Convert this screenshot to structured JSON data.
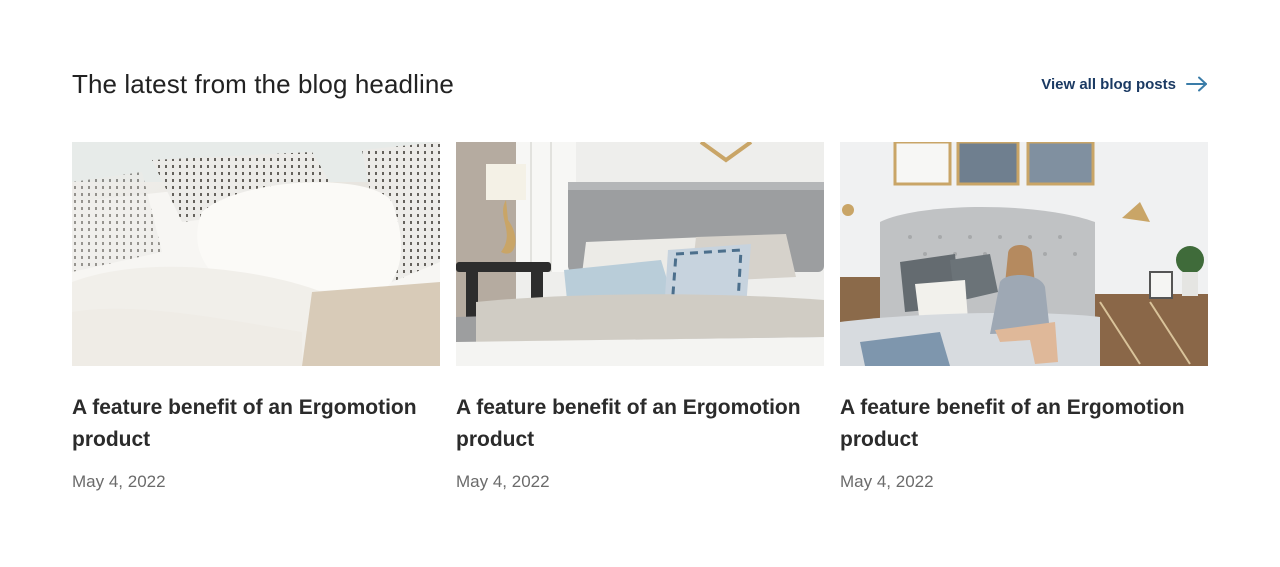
{
  "section": {
    "headline": "The latest from the blog headline",
    "view_all_label": "View all blog posts",
    "view_all_icon": "arrow-right-icon",
    "accent_color": "#1b3a63",
    "arrow_color": "#3a7ca8"
  },
  "cards": [
    {
      "title": "A feature benefit of an Ergomotion product",
      "date": "May 4, 2022",
      "image": "white-bedding-pillows-photo"
    },
    {
      "title": "A feature benefit of an Ergomotion product",
      "date": "May 4, 2022",
      "image": "grey-headboard-bedroom-photo"
    },
    {
      "title": "A feature benefit of an Ergomotion product",
      "date": "May 4, 2022",
      "image": "woman-on-tufted-bed-photo"
    }
  ]
}
